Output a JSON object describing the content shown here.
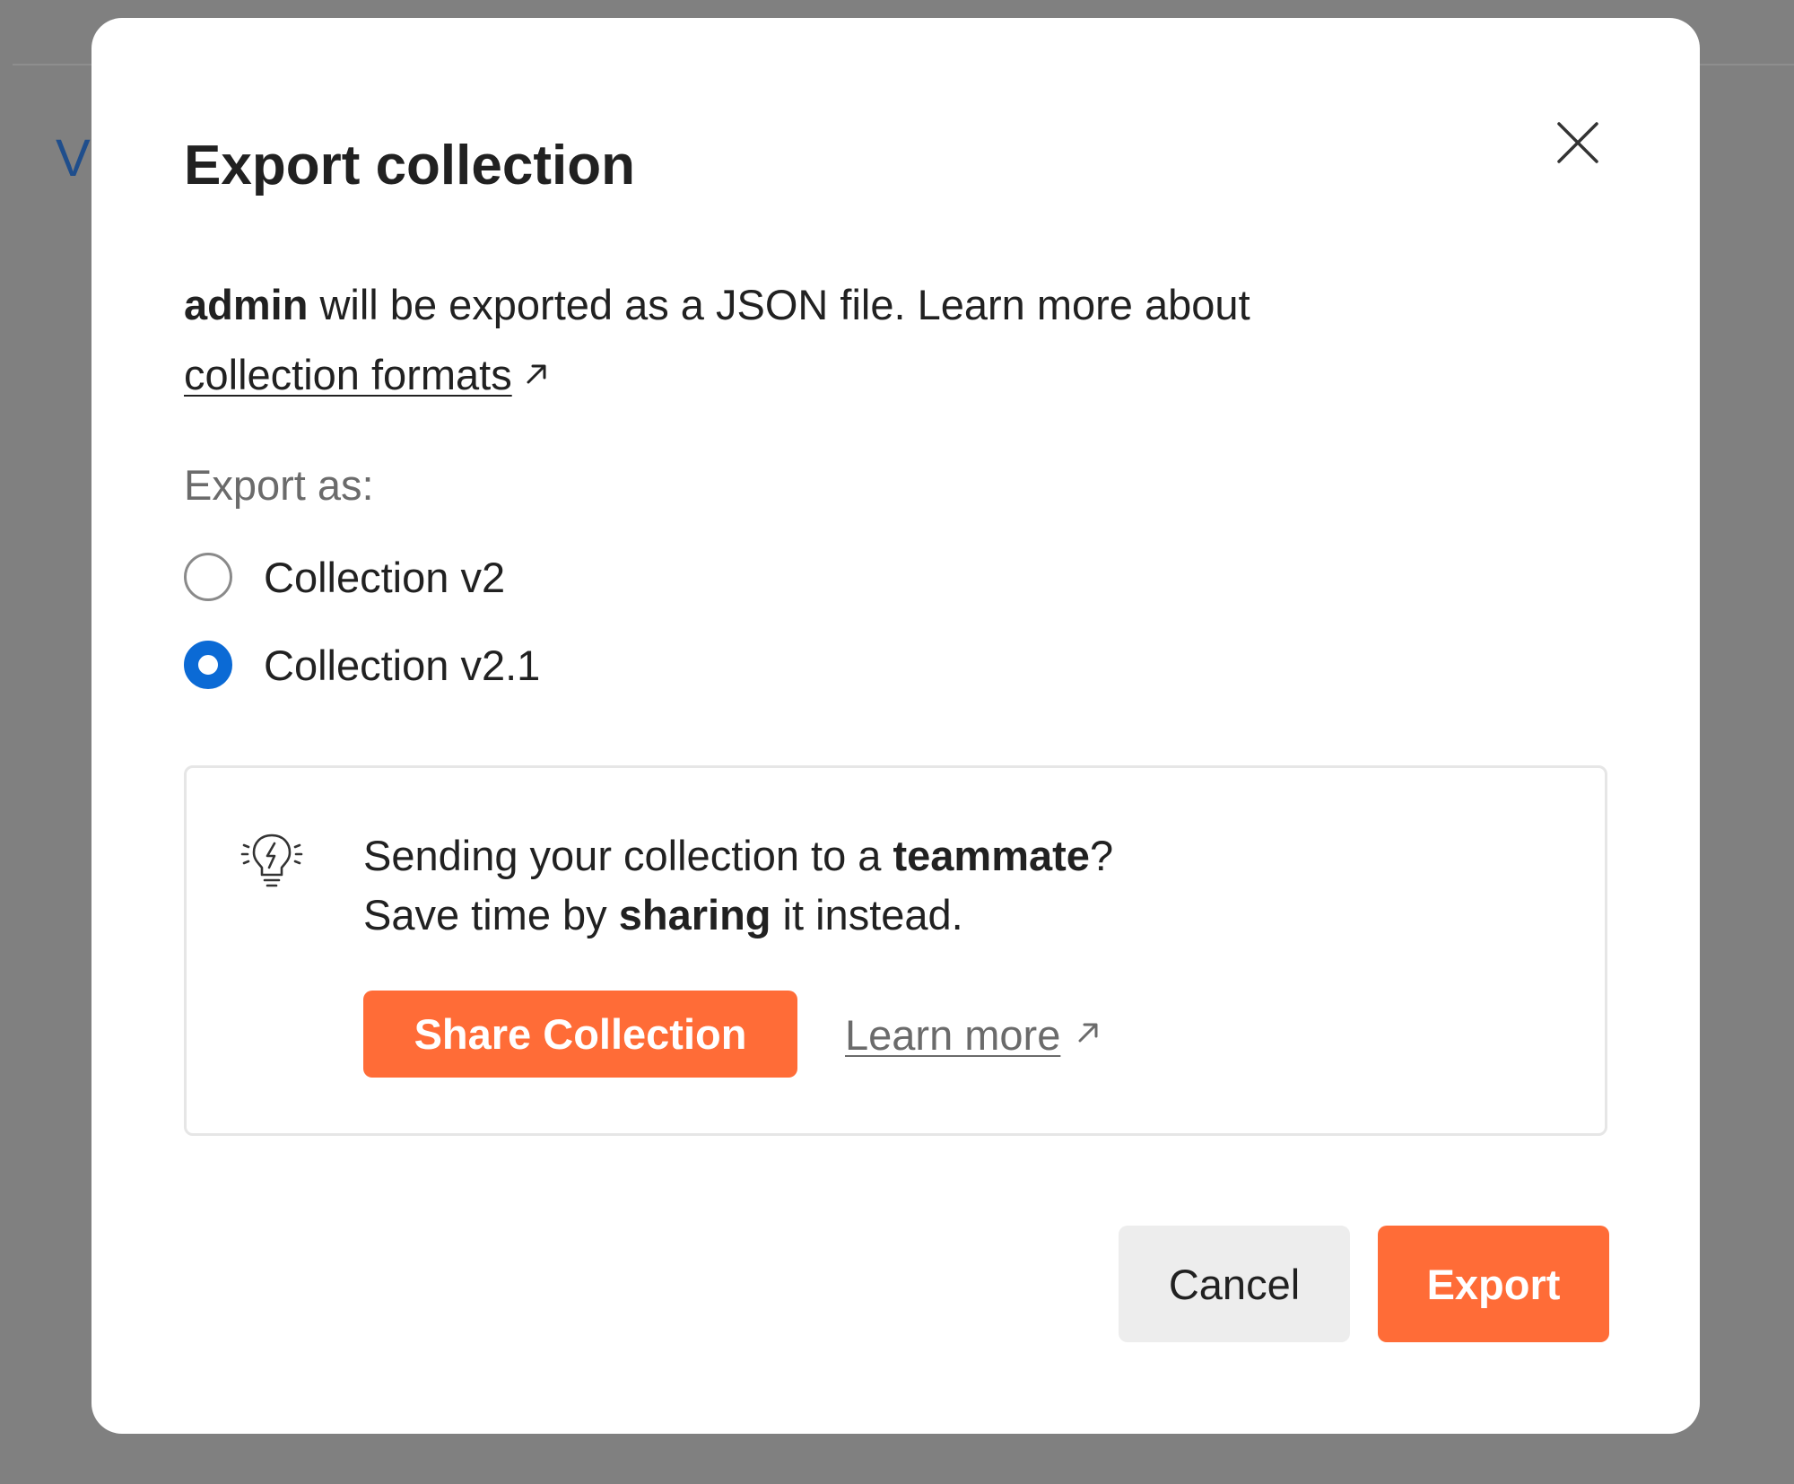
{
  "backdrop": {
    "visible_letter": "V"
  },
  "dialog": {
    "title": "Export collection",
    "description": {
      "collection_name": "admin",
      "text": " will be exported as a JSON file. Learn more about",
      "link_label": "collection formats"
    },
    "export_as_label": "Export as:",
    "options": [
      {
        "label": "Collection v2",
        "selected": false
      },
      {
        "label": "Collection v2.1",
        "selected": true
      }
    ],
    "tip": {
      "line1_prefix": "Sending your collection to a ",
      "line1_bold": "teammate",
      "line1_suffix": "?",
      "line2_prefix": "Save time by ",
      "line2_bold": "sharing",
      "line2_suffix": " it instead.",
      "share_button": "Share Collection",
      "learn_more": "Learn more"
    },
    "cancel_label": "Cancel",
    "export_label": "Export"
  },
  "colors": {
    "overlay": "#808080",
    "accent": "#ff6c37",
    "radio_selected": "#0b6ad5",
    "text": "#212121",
    "muted_text": "#6b6b6b"
  },
  "icons": [
    "close-icon",
    "external-link-icon",
    "lightbulb-icon",
    "radio-checked",
    "radio-unchecked"
  ]
}
